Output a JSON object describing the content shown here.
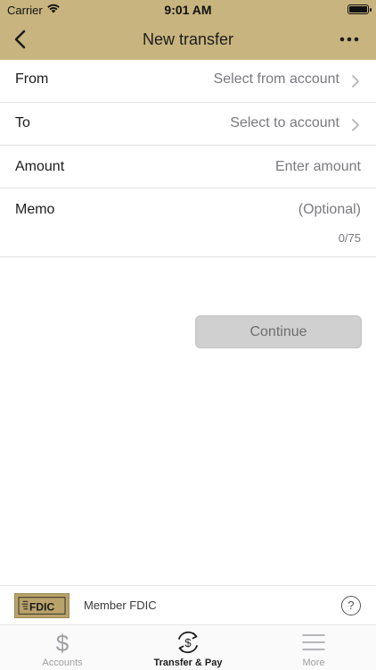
{
  "status": {
    "carrier": "Carrier",
    "time": "9:01 AM"
  },
  "nav": {
    "title": "New transfer"
  },
  "form": {
    "from": {
      "label": "From",
      "value": "Select from account"
    },
    "to": {
      "label": "To",
      "value": "Select to account"
    },
    "amount": {
      "label": "Amount",
      "placeholder": "Enter amount"
    },
    "memo": {
      "label": "Memo",
      "placeholder": "(Optional)",
      "counter": "0/75"
    }
  },
  "continue_label": "Continue",
  "footer": {
    "fdic_logo_text": "FDIC",
    "member_text": "Member FDIC",
    "help_symbol": "?"
  },
  "tabs": [
    {
      "label": "Accounts",
      "icon": "dollar-icon"
    },
    {
      "label": "Transfer & Pay",
      "icon": "transfer-icon",
      "active": true
    },
    {
      "label": "More",
      "icon": "menu-icon"
    }
  ],
  "colors": {
    "header": "#c8b47e",
    "fdic_gold": "#b9a36a",
    "button_disabled": "#d0d0d0"
  }
}
